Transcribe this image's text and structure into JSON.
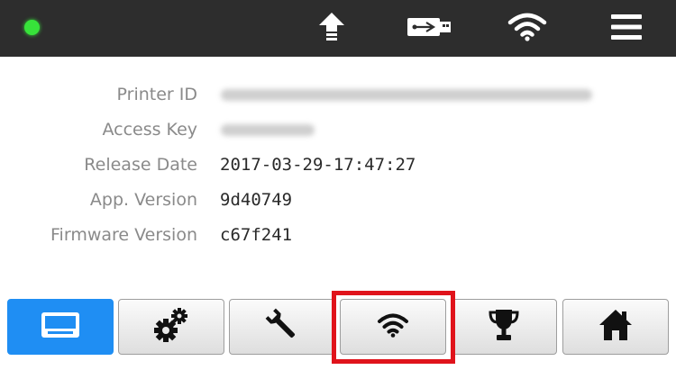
{
  "status": {
    "led_color": "#37e23a"
  },
  "topbar": {
    "icons": [
      "upload-icon",
      "usb-icon",
      "wifi-icon",
      "menu-icon"
    ]
  },
  "info": {
    "printer_id_label": "Printer ID",
    "access_key_label": "Access Key",
    "release_date_label": "Release Date",
    "release_date_value": "2017-03-29-17:47:27",
    "app_version_label": "App. Version",
    "app_version_value": "9d40749",
    "firmware_version_label": "Firmware Version",
    "firmware_version_value": "c67f241"
  },
  "nav": {
    "buttons": [
      "printer-icon",
      "gears-icon",
      "wrench-icon",
      "wifi-icon",
      "trophy-icon",
      "home-icon"
    ],
    "active_index": 0,
    "highlight_index": 3,
    "active_color": "#1f8ef3",
    "highlight_color": "#e0131b"
  }
}
